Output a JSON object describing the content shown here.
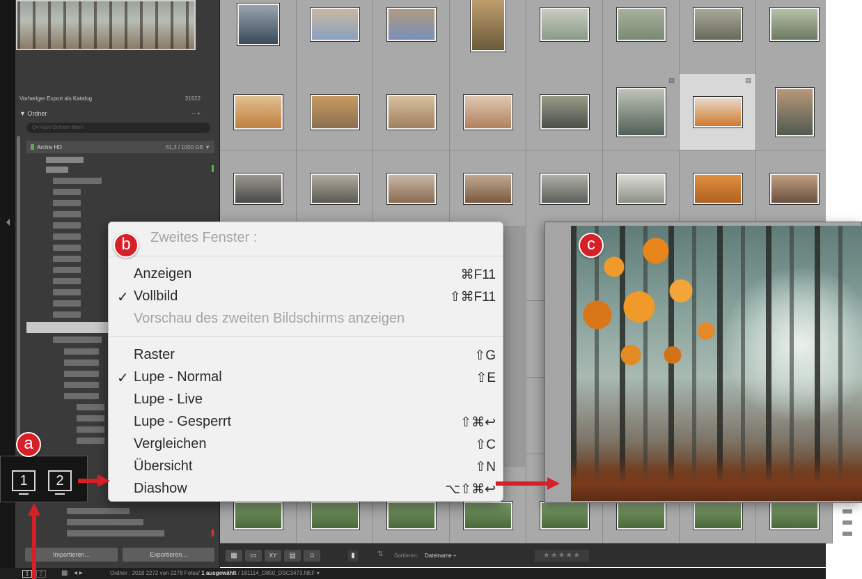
{
  "left_panel": {
    "catalog_item": {
      "label": "Vorheriger Export als Katalog",
      "count": "31922"
    },
    "folders_header": {
      "label": "▼ Ordner",
      "actions": "− +"
    },
    "folder_search_placeholder": "Q▾ Nach Ordnern filtern",
    "volume": {
      "label": "Archiv HD",
      "usage": "61,3 / 1000 GB ▼"
    },
    "import_label": "Importieren...",
    "export_label": "Exportieren..."
  },
  "toolbar": {
    "sort_label": "Sortieren:",
    "sort_value": "Dateiname ÷",
    "stars": "★★★★★"
  },
  "statusbar": {
    "window1": "1",
    "window2": "2",
    "text_prefix": "Ordner : 2018 2272 von 2278 Fotos/",
    "text_bold": "1 ausgewählt",
    "text_suffix": "/ 181114_D850_DSC3473.NEF ▾"
  },
  "menu": {
    "title": "Zweites Fenster :",
    "items": [
      {
        "label": "Anzeigen",
        "shortcut": "⌘F11",
        "checked": ""
      },
      {
        "label": "Vollbild",
        "shortcut": "⇧⌘F11",
        "checked": "✓"
      },
      {
        "label": "Vorschau des zweiten Bildschirms anzeigen",
        "shortcut": "",
        "checked": ""
      },
      {
        "label": "Raster",
        "shortcut": "⇧G",
        "checked": ""
      },
      {
        "label": "Lupe - Normal",
        "shortcut": "⇧E",
        "checked": "✓"
      },
      {
        "label": "Lupe - Live",
        "shortcut": "",
        "checked": ""
      },
      {
        "label": "Lupe - Gesperrt",
        "shortcut": "⇧⌘↩",
        "checked": ""
      },
      {
        "label": "Vergleichen",
        "shortcut": "⇧C",
        "checked": ""
      },
      {
        "label": "Übersicht",
        "shortcut": "⇧N",
        "checked": ""
      },
      {
        "label": "Diashow",
        "shortcut": "⌥⇧⌘↩",
        "checked": ""
      }
    ]
  },
  "window_popup": {
    "button1": "1",
    "button2": "2"
  },
  "badges": {
    "a": "a",
    "b": "b",
    "c": "c"
  },
  "colors": {
    "accent_red": "#d61f26",
    "panel_dark": "#3a3a3a",
    "grid_gray": "#a9a9a9",
    "menu_bg": "#f1f1f1"
  },
  "icons": [
    "grid-view-icon",
    "loupe-view-icon",
    "compare-view-icon",
    "survey-view-icon",
    "people-view-icon",
    "spray-can-icon",
    "sort-direction-icon",
    "star-rating-icon",
    "collapse-left-panel-icon"
  ]
}
